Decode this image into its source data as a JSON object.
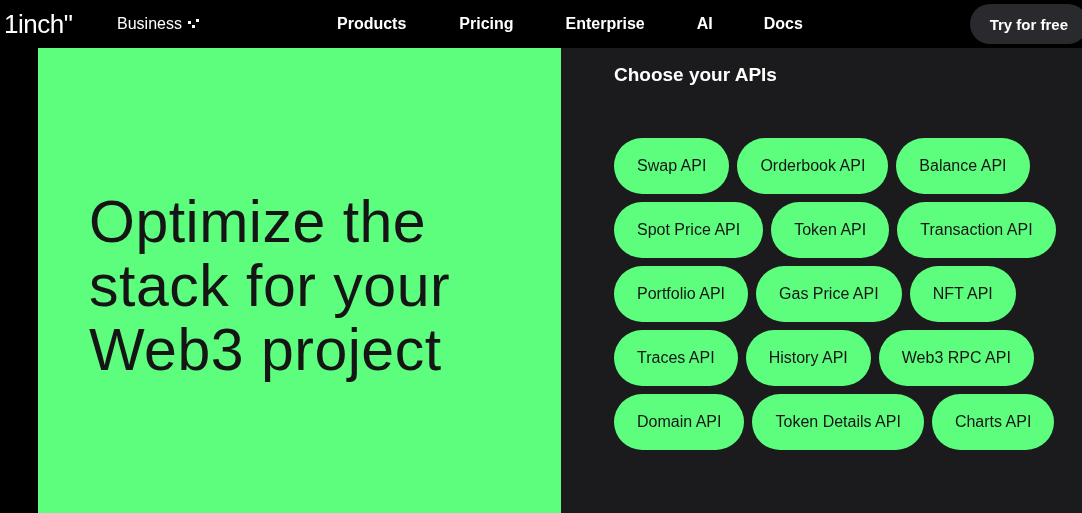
{
  "nav": {
    "logo": "1inch\"",
    "business": "Business",
    "links": [
      "Products",
      "Pricing",
      "Enterprise",
      "AI",
      "Docs"
    ],
    "cta": "Try for free"
  },
  "hero": {
    "headline": "Optimize the stack for your Web3 project"
  },
  "apis": {
    "title": "Choose your APIs",
    "rows": [
      [
        "Swap API",
        "Orderbook API",
        "Balance API"
      ],
      [
        "Spot Price API",
        "Token API",
        "Transaction API"
      ],
      [
        "Portfolio API",
        "Gas Price API",
        "NFT API"
      ],
      [
        "Traces API",
        "History API",
        "Web3 RPC API"
      ],
      [
        "Domain API",
        "Token Details API",
        "Charts API"
      ]
    ]
  }
}
